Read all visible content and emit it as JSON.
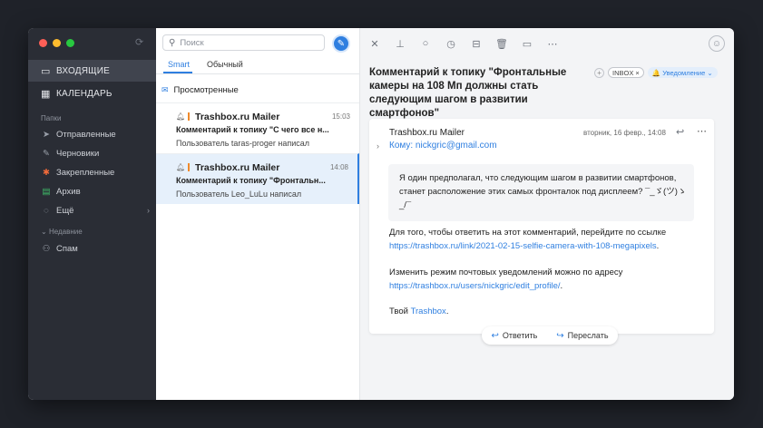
{
  "sidebar": {
    "main": [
      {
        "label": "ВХОДЯЩИЕ",
        "icon": "inbox-icon"
      },
      {
        "label": "КАЛЕНДАРЬ",
        "icon": "calendar-icon"
      }
    ],
    "folders_label": "Папки",
    "folders": [
      {
        "label": "Отправленные",
        "icon": "send-icon"
      },
      {
        "label": "Черновики",
        "icon": "pencil-icon"
      },
      {
        "label": "Закрепленные",
        "icon": "pin-icon"
      },
      {
        "label": "Архив",
        "icon": "archive-icon"
      },
      {
        "label": "Ещё",
        "icon": "more-circle-icon"
      }
    ],
    "recent_label": "Недавние",
    "recent": [
      {
        "label": "Спам",
        "icon": "user-icon"
      }
    ]
  },
  "list": {
    "search_placeholder": "Поиск",
    "tabs": [
      "Smart",
      "Обычный"
    ],
    "group_header": "Просмотренные",
    "messages": [
      {
        "sender": "Trashbox.ru Mailer",
        "time": "15:03",
        "subject": "Комментарий к топику \"С чего все н...",
        "preview": "Пользователь taras-proger написал"
      },
      {
        "sender": "Trashbox.ru Mailer",
        "time": "14:08",
        "subject": "Комментарий к топику \"Фронтальн...",
        "preview": "Пользователь Leo_LuLu написал"
      }
    ]
  },
  "reader": {
    "subject": "Комментарий к топику \"Фронтальные камеры на 108 Мп должны стать следующим шагом в развитии смартфонов\"",
    "tags": {
      "add": "+",
      "inbox": "INBOX ×",
      "notification": "🔔 Уведомление ⌄"
    },
    "from": "Trashbox.ru Mailer",
    "to": "Кому: nickgric@gmail.com",
    "date": "вторник, 16 февр., 14:08",
    "quote": "Я один предполагал, что следующим шагом в развитии смартфонов, станет расположение этих самых фронталок под дисплеем? ¯_ゞ(ツ)ゝ_/¯",
    "para1_text": "Для того, чтобы ответить на этот комментарий, перейдите по ссылке",
    "para1_link": "https://trashbox.ru/link/2021-02-15-selfie-camera-with-108-megapixels",
    "para1_end": ".",
    "para2_text": "Изменить режим почтовых уведомлений можно по адресу",
    "para2_link": "https://trashbox.ru/users/nickgric/edit_profile/",
    "para2_end": ".",
    "sign_text": "Твой",
    "sign_link": "Trashbox",
    "sign_end": ".",
    "reply_label": "Ответить",
    "forward_label": "Переслать"
  },
  "colors": {
    "accent": "#2f7fe0",
    "sidebar_bg": "#2a2d35",
    "traffic_red": "#fe5f57",
    "traffic_yellow": "#febc2e",
    "traffic_green": "#28c840",
    "flag_orange": "#f08a2b"
  }
}
